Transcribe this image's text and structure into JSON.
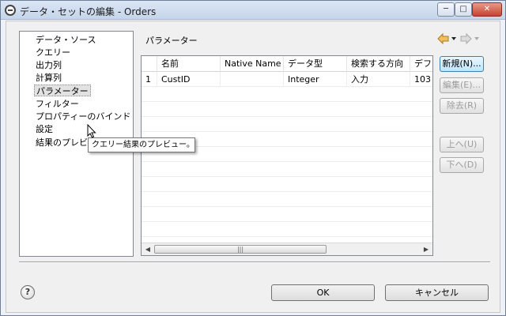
{
  "window": {
    "title": "データ・セットの編集 - Orders",
    "controls": {
      "minimize": "─",
      "maximize": "□",
      "close": "✕"
    }
  },
  "nav": {
    "items": [
      {
        "label": "データ・ソース",
        "selected": false
      },
      {
        "label": "クエリー",
        "selected": false
      },
      {
        "label": "出力列",
        "selected": false
      },
      {
        "label": "計算列",
        "selected": false
      },
      {
        "label": "パラメーター",
        "selected": true
      },
      {
        "label": "フィルター",
        "selected": false
      },
      {
        "label": "プロパティーのバインド",
        "selected": false
      },
      {
        "label": "設定",
        "selected": false
      },
      {
        "label": "結果のプレビュー",
        "selected": false
      }
    ]
  },
  "tooltip": {
    "text": "クエリー結果のプレビュー。"
  },
  "section": {
    "title": "パラメーター"
  },
  "table": {
    "columns": [
      "",
      "名前",
      "Native Name",
      "データ型",
      "検索する方向",
      "デフォ"
    ],
    "rows": [
      [
        "1",
        "CustID",
        "",
        "Integer",
        "入力",
        "103"
      ]
    ],
    "scroll_thumb": "|||"
  },
  "side_buttons": {
    "new": "新規(N)...",
    "edit": "編集(E)...",
    "remove": "除去(R)",
    "up": "上へ(U)",
    "down": "下へ(D)"
  },
  "footer": {
    "help": "?",
    "ok": "OK",
    "cancel": "キャンセル"
  },
  "colors": {
    "titlebar": "#c6d5ea",
    "dialog_bg": "#f0f0f0",
    "accent_button": "#bee6fd",
    "nav_arrow": "#e8a33a"
  },
  "icons": {
    "back": "back-arrow-icon",
    "forward": "forward-arrow-icon",
    "dropdown": "dropdown-triangle-icon",
    "help": "help-icon",
    "cursor": "mouse-cursor-icon"
  }
}
